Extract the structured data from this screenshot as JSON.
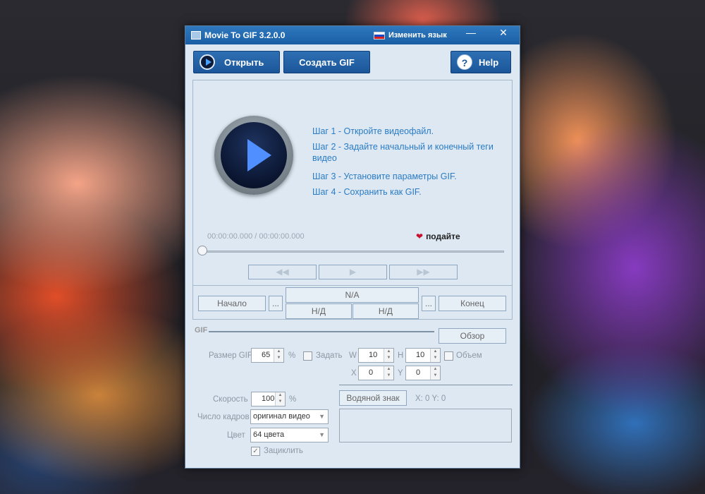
{
  "window": {
    "title": "Movie To GIF 3.2.0.0",
    "language_button": "Изменить язык",
    "minimize": "—",
    "close": "✕"
  },
  "toolbar": {
    "open_label": "Открыть",
    "create_label": "Создать GIF",
    "help_label": "Help",
    "help_glyph": "?"
  },
  "player": {
    "steps": [
      "Шаг 1 - Откройте видеофайл.",
      "Шаг 2 - Задайте начальный и конечный теги видео",
      "Шаг 3 - Установите параметры GIF.",
      "Шаг 4 - Сохранить как GIF."
    ],
    "timecode": "00:00:00.000 / 00:00:00.000",
    "donate_heart": "❤",
    "donate_label": "подайте",
    "rewind": "◀◀",
    "play": "▶",
    "forward": "▶▶"
  },
  "range": {
    "start_label": "Начало",
    "dots": "...",
    "na": "N/A",
    "nd1": "Н/Д",
    "nd2": "Н/Д",
    "end_label": "Конец"
  },
  "gif": {
    "section_label": "GIF",
    "browse_label": "Обзор",
    "size_label": "Размер GIF",
    "size_value": "65",
    "percent": "%",
    "set_label": "Задать",
    "w_label": "W",
    "w_value": "10",
    "h_label": "H",
    "h_value": "10",
    "volume_label": "Объем",
    "x_label": "X",
    "x_value": "0",
    "y_label": "Y",
    "y_value": "0",
    "speed_label": "Скорость",
    "speed_value": "100",
    "frames_label": "Число кадров",
    "frames_value": "оригинал видео",
    "color_label": "Цвет",
    "color_value": "64 цвета",
    "loop_label": "Зациклить",
    "loop_check": "✓",
    "watermark_label": "Водяной знак",
    "wm_coords": "X: 0  Y: 0",
    "spin_arrows": "▲\n▼",
    "select_arrow": "▼"
  },
  "colors": {
    "titlebar": "#1a5fa5",
    "accent_text": "#2b7cc5",
    "panel_bg": "#dde8f2",
    "play_icon": "#4f8fff",
    "heart": "#c8102e"
  },
  "icons": [
    "app-icon",
    "flag-ru-icon",
    "open-play-icon",
    "help-icon",
    "big-play-icon",
    "heart-icon",
    "rewind-icon",
    "play-icon",
    "fast-forward-icon"
  ]
}
